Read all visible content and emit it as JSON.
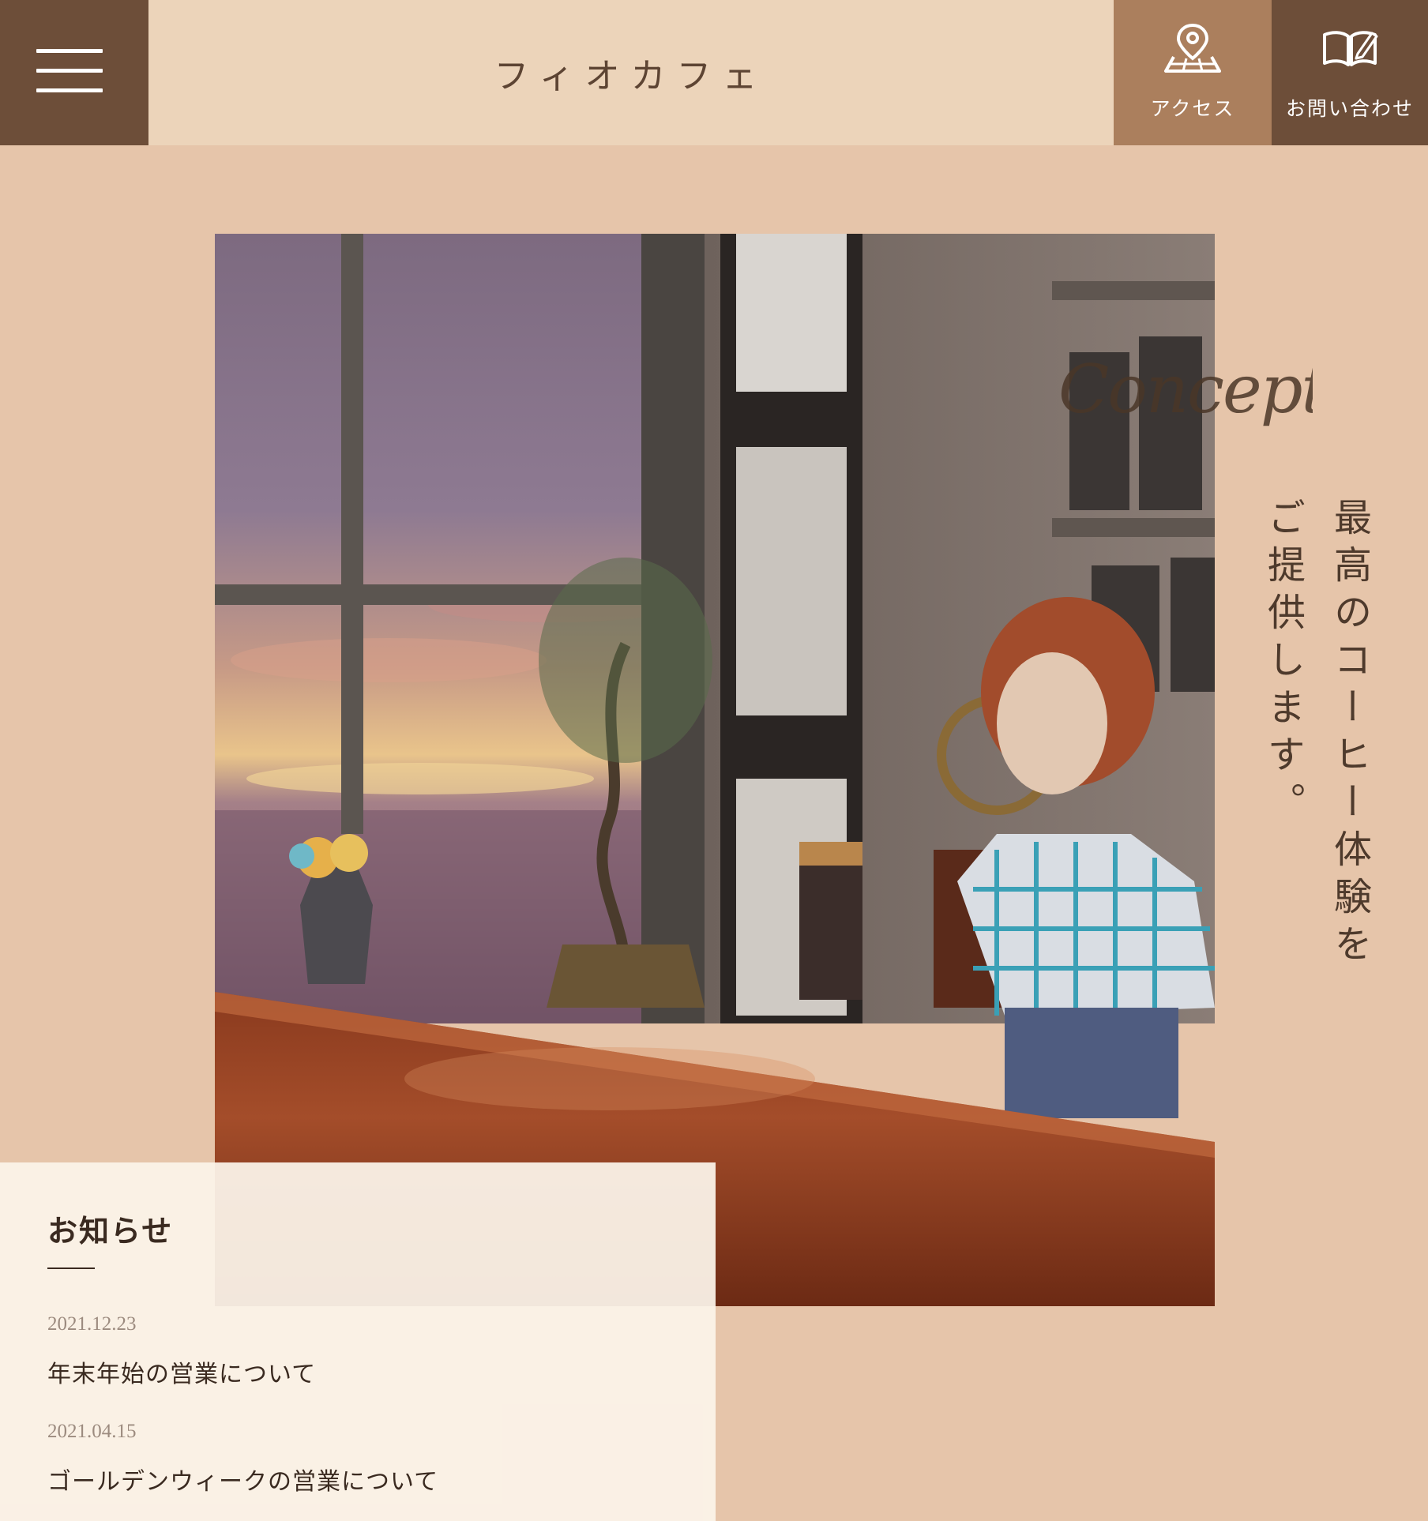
{
  "header": {
    "site_title": "フィオカフェ",
    "access_label": "アクセス",
    "contact_label": "お問い合わせ"
  },
  "hero": {
    "concept_word": "Concept",
    "catchphrase": "最高のコーヒー体験をご提供します。"
  },
  "news": {
    "title": "お知らせ",
    "items": [
      {
        "date": "2021.12.23",
        "text": "年末年始の営業について"
      },
      {
        "date": "2021.04.15",
        "text": "ゴールデンウィークの営業について"
      }
    ]
  }
}
